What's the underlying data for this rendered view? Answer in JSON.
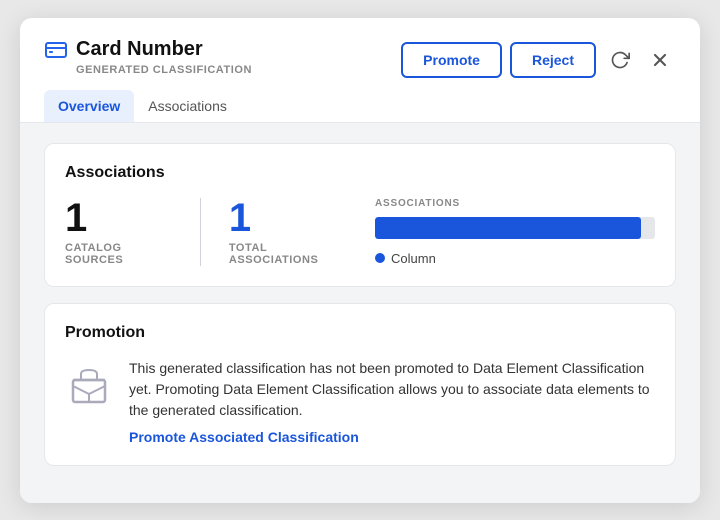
{
  "header": {
    "icon": "card-icon",
    "title": "Card Number",
    "subtitle": "GENERATED CLASSIFICATION",
    "promote_label": "Promote",
    "reject_label": "Reject"
  },
  "tabs": [
    {
      "id": "overview",
      "label": "Overview",
      "active": true
    },
    {
      "id": "associations",
      "label": "Associations",
      "active": false
    }
  ],
  "associations_section": {
    "title": "Associations",
    "catalog_sources_number": "1",
    "catalog_sources_label": "CATALOG SOURCES",
    "total_associations_number": "1",
    "total_associations_label": "TOTAL ASSOCIATIONS",
    "chart_label": "ASSOCIATIONS",
    "legend_label": "Column",
    "bar_percent": 95
  },
  "promotion_section": {
    "title": "Promotion",
    "description": "This generated classification has not been promoted to Data Element Classification yet. Promoting Data Element Classification allows you to associate data elements to the generated classification.",
    "link_label": "Promote Associated Classification"
  }
}
